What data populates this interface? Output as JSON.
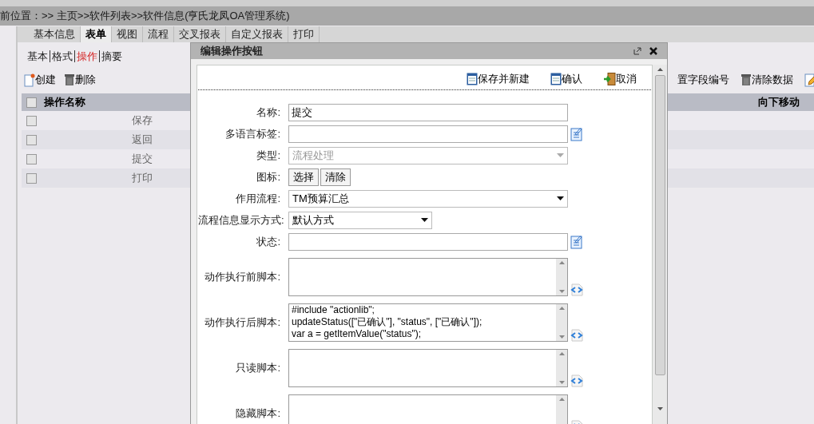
{
  "breadcrumb": "前位置：>> 主页>>软件列表>>软件信息(亨氏龙凤OA管理系统)",
  "tabs": [
    {
      "label": "基本信息",
      "selected": false
    },
    {
      "label": "表单",
      "selected": true
    },
    {
      "label": "视图",
      "selected": false
    },
    {
      "label": "流程",
      "selected": false
    },
    {
      "label": "交叉报表",
      "selected": false
    },
    {
      "label": "自定义报表",
      "selected": false
    },
    {
      "label": "打印",
      "selected": false
    }
  ],
  "subtabs": [
    {
      "label": "基本",
      "selected": false
    },
    {
      "label": "格式",
      "selected": false
    },
    {
      "label": "操作",
      "selected": true
    },
    {
      "label": "摘要",
      "selected": false
    }
  ],
  "toolbar": [
    {
      "label": "创建",
      "kind": "new"
    },
    {
      "label": "删除",
      "kind": "trash"
    }
  ],
  "right_toolbar": [
    {
      "label": "置字段编号",
      "kind": "plain"
    },
    {
      "label": "清除数据",
      "kind": "trash"
    },
    {
      "kind": "edit"
    }
  ],
  "table": {
    "header_checked": false,
    "columns": [
      "操作名称",
      "向下移动"
    ],
    "rows": [
      {
        "name": "保存",
        "checked": false
      },
      {
        "name": "返回",
        "checked": false
      },
      {
        "name": "提交",
        "checked": false
      },
      {
        "name": "打印",
        "checked": false
      }
    ]
  },
  "dialog": {
    "title": "编辑操作按钮",
    "actions": [
      {
        "label": "保存并新建",
        "kind": "save"
      },
      {
        "label": "确认",
        "kind": "save"
      },
      {
        "label": "取消",
        "kind": "exit"
      }
    ],
    "fields": [
      {
        "label": "名称:",
        "kind": "text",
        "value": "提交"
      },
      {
        "label": "多语言标签:",
        "kind": "text_note"
      },
      {
        "label": "类型:",
        "kind": "select",
        "value": "流程处理",
        "disabled": true
      },
      {
        "label": "图标:",
        "kind": "buttons",
        "buttons": [
          "选择",
          "清除"
        ]
      },
      {
        "label": "作用流程:",
        "kind": "select",
        "value": "TM预算汇总",
        "disabled": false
      },
      {
        "label": "流程信息显示方式:",
        "kind": "select_narrow",
        "value": "默认方式",
        "disabled": false
      },
      {
        "label": "状态:",
        "kind": "text_note"
      },
      {
        "label": "动作执行前脚本:",
        "kind": "script"
      },
      {
        "label": "动作执行后脚本:",
        "kind": "script",
        "value": "#include \"actionlib\";\nupdateStatus([\"已确认\"], \"status\", [\"已确认\"]);\nvar a = getItemValue(\"status\");"
      },
      {
        "label": "只读脚本:",
        "kind": "script"
      },
      {
        "label": "隐藏脚本:",
        "kind": "script"
      }
    ]
  }
}
